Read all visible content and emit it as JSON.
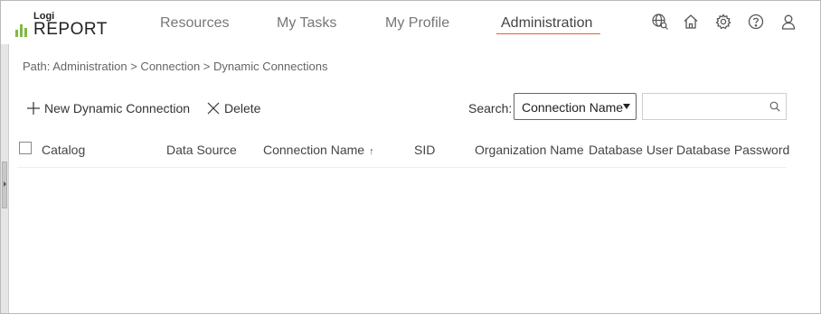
{
  "logo": {
    "small": "Logi",
    "big": "REPORT",
    "bar_color": "#7fba42"
  },
  "nav": {
    "items": [
      {
        "label": "Resources"
      },
      {
        "label": "My Tasks"
      },
      {
        "label": "My Profile"
      },
      {
        "label": "Administration",
        "active": true
      }
    ],
    "active_underline_color": "#e8613a"
  },
  "header_icons": [
    "globe-search-icon",
    "home-icon",
    "gear-icon",
    "help-icon",
    "user-icon"
  ],
  "path": "Path: Administration > Connection > Dynamic Connections",
  "toolbar": {
    "new_label": "New Dynamic Connection",
    "delete_label": "Delete"
  },
  "search": {
    "label": "Search:",
    "field_selected": "Connection Name",
    "value": ""
  },
  "table": {
    "columns": [
      {
        "label": "Catalog"
      },
      {
        "label": "Data Source"
      },
      {
        "label": "Connection Name",
        "sort": "ascending"
      },
      {
        "label": "SID"
      },
      {
        "label": "Organization Name"
      },
      {
        "label": "Database User"
      },
      {
        "label": "Database Password"
      }
    ],
    "sort_glyph": "↑",
    "rows": []
  }
}
